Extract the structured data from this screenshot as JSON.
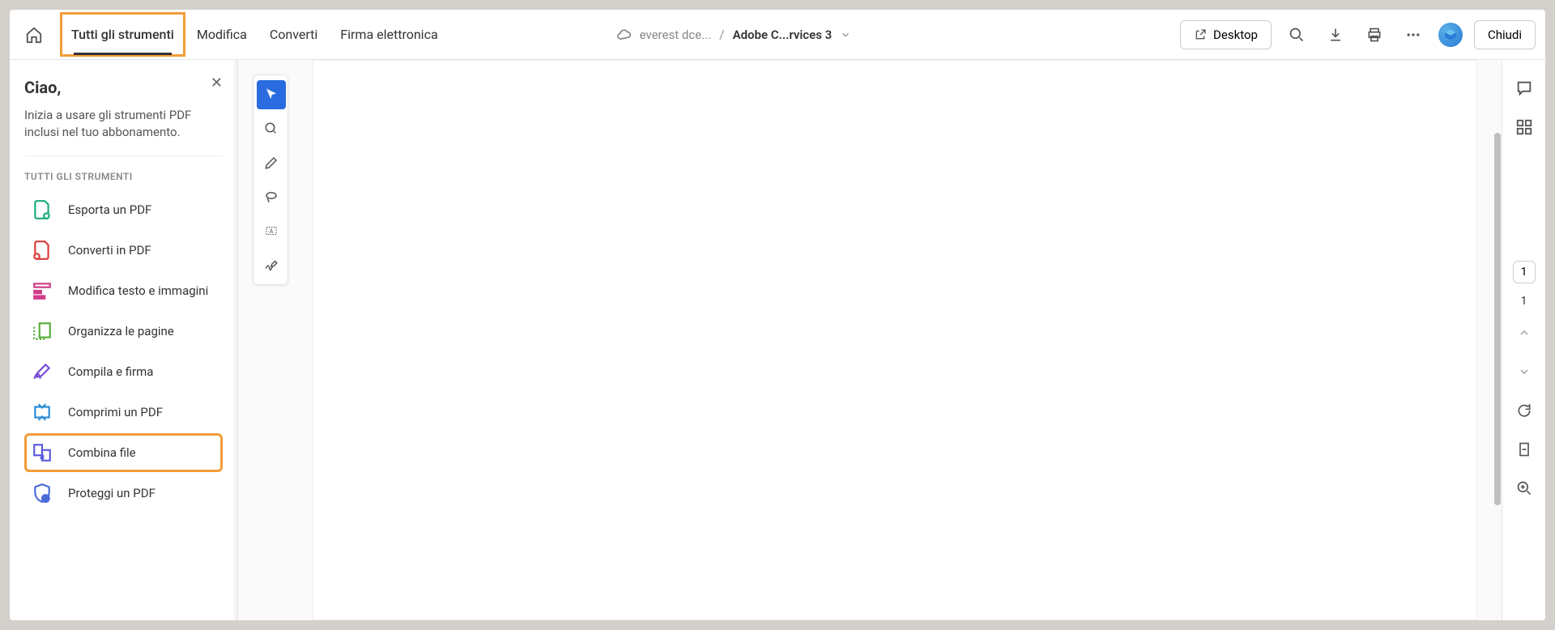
{
  "topbar": {
    "nav": [
      "Tutti gli strumenti",
      "Modifica",
      "Converti",
      "Firma elettronica"
    ],
    "active_nav_index": 0,
    "breadcrumb_folder": "everest dce...",
    "breadcrumb_file": "Adobe C...rvices 3",
    "desktop_label": "Desktop",
    "close_label": "Chiudi"
  },
  "sidebar": {
    "greeting": "Ciao,",
    "subtext": "Inizia a usare gli strumenti PDF inclusi nel tuo abbonamento.",
    "section_label": "TUTTI GLI STRUMENTI",
    "tools": [
      {
        "label": "Esporta un PDF",
        "icon": "export-pdf"
      },
      {
        "label": "Converti in PDF",
        "icon": "convert-pdf"
      },
      {
        "label": "Modifica testo e immagini",
        "icon": "edit-text"
      },
      {
        "label": "Organizza le pagine",
        "icon": "organize-pages"
      },
      {
        "label": "Compila e firma",
        "icon": "fill-sign"
      },
      {
        "label": "Comprimi un PDF",
        "icon": "compress-pdf"
      },
      {
        "label": "Combina file",
        "icon": "combine-files"
      },
      {
        "label": "Proteggi un PDF",
        "icon": "protect-pdf"
      }
    ],
    "highlighted_tool_index": 6
  },
  "right_rail": {
    "page_badge": "1",
    "page_number": "1"
  }
}
